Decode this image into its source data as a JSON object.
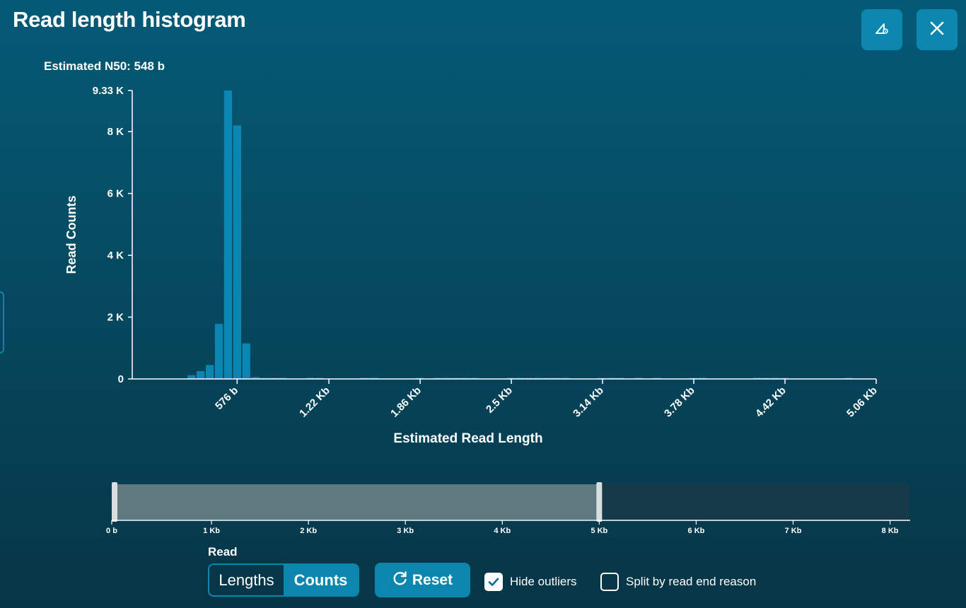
{
  "header": {
    "title": "Read length histogram",
    "settings_icon": "chart-settings-icon",
    "close_icon": "close-icon"
  },
  "summary": {
    "n50": "Estimated N50: 548 b"
  },
  "colors": {
    "accent": "#0c86ad",
    "bar": "#0a86b3",
    "selection": "#5e7a80",
    "track": "#173a48"
  },
  "chart_data": {
    "type": "bar",
    "xlabel": "Estimated Read Length",
    "ylabel": "Read Counts",
    "ylim": [
      0,
      9330
    ],
    "xlim": [
      -160,
      5060
    ],
    "y_ticks": [
      {
        "value": 0,
        "label": "0"
      },
      {
        "value": 2000,
        "label": "2 K"
      },
      {
        "value": 4000,
        "label": "4 K"
      },
      {
        "value": 6000,
        "label": "6 K"
      },
      {
        "value": 8000,
        "label": "8 K"
      },
      {
        "value": 9330,
        "label": "9.33 K"
      }
    ],
    "x_ticks": [
      {
        "value": 576,
        "label": "576 b"
      },
      {
        "value": 1220,
        "label": "1.22 Kb"
      },
      {
        "value": 1860,
        "label": "1.86 Kb"
      },
      {
        "value": 2500,
        "label": "2.5 Kb"
      },
      {
        "value": 3140,
        "label": "3.14 Kb"
      },
      {
        "value": 3780,
        "label": "3.78 Kb"
      },
      {
        "value": 4420,
        "label": "4.42 Kb"
      },
      {
        "value": 5060,
        "label": "5.06 Kb"
      }
    ],
    "bin_width": 64,
    "bins": [
      {
        "x": 224,
        "count": 120
      },
      {
        "x": 288,
        "count": 250
      },
      {
        "x": 352,
        "count": 450
      },
      {
        "x": 416,
        "count": 1780
      },
      {
        "x": 480,
        "count": 9330
      },
      {
        "x": 544,
        "count": 8200
      },
      {
        "x": 608,
        "count": 1150
      },
      {
        "x": 672,
        "count": 60
      },
      {
        "x": 736,
        "count": 25
      },
      {
        "x": 800,
        "count": 15
      },
      {
        "x": 864,
        "count": 10
      },
      {
        "x": 1056,
        "count": 10
      },
      {
        "x": 1120,
        "count": 10
      },
      {
        "x": 1440,
        "count": 10
      },
      {
        "x": 1504,
        "count": 10
      },
      {
        "x": 1824,
        "count": 10
      },
      {
        "x": 1952,
        "count": 10
      },
      {
        "x": 2016,
        "count": 10
      },
      {
        "x": 2080,
        "count": 10
      },
      {
        "x": 2144,
        "count": 10
      },
      {
        "x": 2208,
        "count": 10
      },
      {
        "x": 2464,
        "count": 10
      },
      {
        "x": 2528,
        "count": 10
      },
      {
        "x": 2592,
        "count": 10
      },
      {
        "x": 2656,
        "count": 10
      },
      {
        "x": 2720,
        "count": 10
      },
      {
        "x": 2784,
        "count": 10
      },
      {
        "x": 2848,
        "count": 10
      },
      {
        "x": 3104,
        "count": 10
      },
      {
        "x": 3168,
        "count": 10
      },
      {
        "x": 3232,
        "count": 10
      },
      {
        "x": 3360,
        "count": 10
      },
      {
        "x": 3488,
        "count": 10
      },
      {
        "x": 3744,
        "count": 10
      },
      {
        "x": 3808,
        "count": 10
      },
      {
        "x": 4192,
        "count": 10
      },
      {
        "x": 4256,
        "count": 10
      },
      {
        "x": 4320,
        "count": 10
      },
      {
        "x": 4384,
        "count": 10
      },
      {
        "x": 4832,
        "count": 10
      }
    ]
  },
  "range_slider": {
    "min": 0,
    "max": 8200,
    "selected": [
      0,
      5000
    ],
    "ticks": [
      {
        "value": 0,
        "label": "0 b"
      },
      {
        "value": 1000,
        "label": "1 Kb"
      },
      {
        "value": 2000,
        "label": "2 Kb"
      },
      {
        "value": 3000,
        "label": "3 Kb"
      },
      {
        "value": 4000,
        "label": "4 Kb"
      },
      {
        "value": 5000,
        "label": "5 Kb"
      },
      {
        "value": 6000,
        "label": "6 Kb"
      },
      {
        "value": 7000,
        "label": "7 Kb"
      },
      {
        "value": 8000,
        "label": "8 Kb"
      }
    ]
  },
  "controls": {
    "read_label": "Read",
    "toggle": [
      {
        "label": "Lengths",
        "active": false
      },
      {
        "label": "Counts",
        "active": true
      }
    ],
    "reset_label": "Reset",
    "hide_outliers_label": "Hide outliers",
    "hide_outliers_checked": true,
    "split_label": "Split by read end reason",
    "split_checked": false
  }
}
